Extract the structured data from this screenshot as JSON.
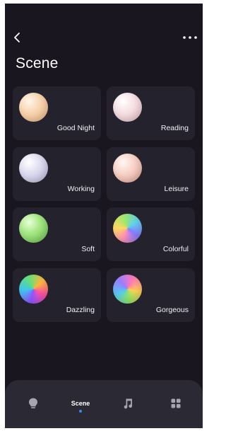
{
  "header": {
    "title": "Scene"
  },
  "scenes": [
    {
      "label": "Good Night",
      "orb": "radial-gradient(circle at 35% 30%, #fff5ea 0%, #f8d4ae 42%, #e9b287 100%)"
    },
    {
      "label": "Reading",
      "orb": "radial-gradient(circle at 35% 30%, #ffffff 0%, #f4dde0 45%, #e4bcc2 100%)"
    },
    {
      "label": "Working",
      "orb": "radial-gradient(circle at 35% 30%, #ffffff 0%, #dad9ee 45%, #b7b6d9 100%)"
    },
    {
      "label": "Leisure",
      "orb": "radial-gradient(circle at 35% 30%, #fff7f2 0%, #f6cfc4 45%, #e4a597 100%)"
    },
    {
      "label": "Soft",
      "orb": "radial-gradient(circle at 35% 30%, #e9ffd8 0%, #a4e684 40%, #6cbd4c 100%)"
    },
    {
      "label": "Colorful",
      "orb": "conic-gradient(from 200deg, #ff8fb5, #ffd85f, #9be86c, #5fd0ee, #8a7bff, #ff8fb5)"
    },
    {
      "label": "Dazzling",
      "orb": "conic-gradient(from 120deg, #ff4fa3, #8f54ff, #3dc6f0, #64e07a, #ffb53d, #ff4fa3)"
    },
    {
      "label": "Gorgeous",
      "orb": "conic-gradient(from 30deg, #ff7ab6, #ffcf55, #8ce566, #56c6f2, #9b7cff, #ff7ab6)"
    }
  ],
  "bottom_nav": {
    "items": [
      {
        "name": "lights",
        "icon": "bulb-icon"
      },
      {
        "name": "scene",
        "label": "Scene",
        "active": true
      },
      {
        "name": "music",
        "icon": "music-icon"
      },
      {
        "name": "apps",
        "icon": "grid-icon"
      }
    ],
    "active_color": "#3f82f0"
  }
}
